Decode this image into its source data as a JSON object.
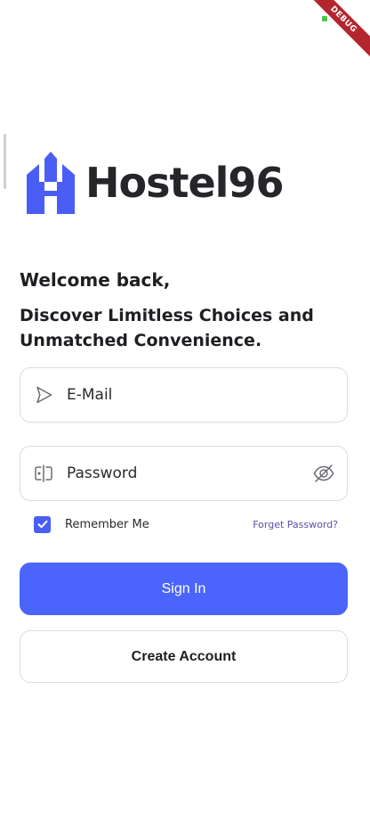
{
  "debug_banner": "DEBUG",
  "brand": {
    "name": "Hostel96",
    "logo_color": "#4a5ef5",
    "text_color": "#25252a"
  },
  "heading": {
    "welcome": "Welcome back,",
    "tagline": "Discover Limitless Choices and Unmatched Convenience."
  },
  "form": {
    "email": {
      "placeholder": "E-Mail",
      "value": "",
      "icon": "send-icon"
    },
    "password": {
      "placeholder": "Password",
      "value": "",
      "icon": "password-icon",
      "toggle_icon": "eye-slash-icon"
    },
    "remember_me": {
      "label": "Remember Me",
      "checked": true
    },
    "forget_password": "Forget Password?"
  },
  "actions": {
    "sign_in": "Sign In",
    "create_account": "Create Account"
  },
  "colors": {
    "primary": "#4b64fb",
    "link": "#5b4fa6",
    "border": "#dcdce0"
  }
}
